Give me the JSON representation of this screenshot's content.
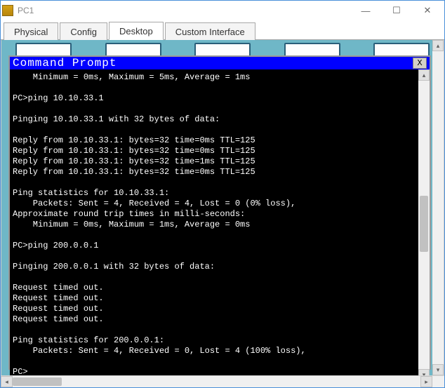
{
  "window": {
    "title": "PC1",
    "buttons": {
      "min": "—",
      "max": "☐",
      "close": "✕"
    }
  },
  "tabs": [
    {
      "label": "Physical",
      "active": false
    },
    {
      "label": "Config",
      "active": false
    },
    {
      "label": "Desktop",
      "active": true
    },
    {
      "label": "Custom Interface",
      "active": false
    }
  ],
  "cmd": {
    "title": "Command Prompt",
    "close": "X",
    "scroll": {
      "up": "▴",
      "down": "▾"
    },
    "lines": [
      "    Minimum = 0ms, Maximum = 5ms, Average = 1ms",
      "",
      "PC>ping 10.10.33.1",
      "",
      "Pinging 10.10.33.1 with 32 bytes of data:",
      "",
      "Reply from 10.10.33.1: bytes=32 time=0ms TTL=125",
      "Reply from 10.10.33.1: bytes=32 time=0ms TTL=125",
      "Reply from 10.10.33.1: bytes=32 time=1ms TTL=125",
      "Reply from 10.10.33.1: bytes=32 time=0ms TTL=125",
      "",
      "Ping statistics for 10.10.33.1:",
      "    Packets: Sent = 4, Received = 4, Lost = 0 (0% loss),",
      "Approximate round trip times in milli-seconds:",
      "    Minimum = 0ms, Maximum = 1ms, Average = 0ms",
      "",
      "PC>ping 200.0.0.1",
      "",
      "Pinging 200.0.0.1 with 32 bytes of data:",
      "",
      "Request timed out.",
      "Request timed out.",
      "Request timed out.",
      "Request timed out.",
      "",
      "Ping statistics for 200.0.0.1:",
      "    Packets: Sent = 4, Received = 0, Lost = 4 (100% loss),",
      "",
      "PC>"
    ]
  },
  "hscroll": {
    "left": "◂",
    "right": "▸"
  }
}
